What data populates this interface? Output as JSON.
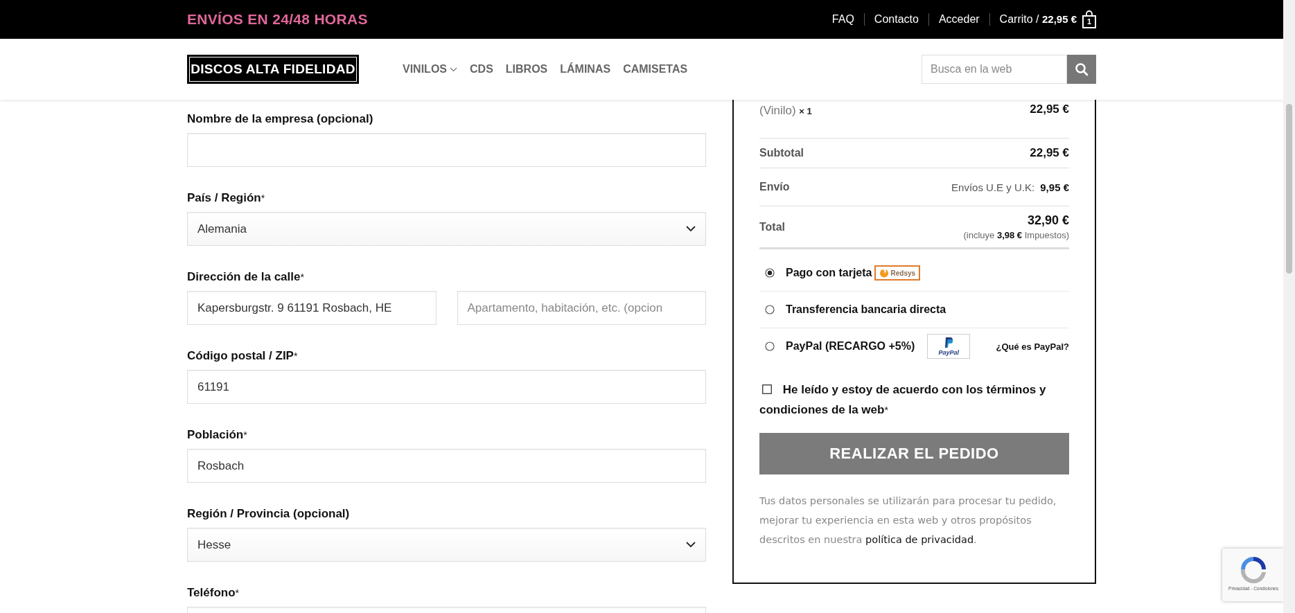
{
  "top_bar": {
    "promo": "ENVÍOS EN 24/48 HORAS",
    "links": [
      "FAQ",
      "Contacto",
      "Acceder"
    ],
    "cart": {
      "label": "Carrito /",
      "total": "22,95 €",
      "count": "1"
    }
  },
  "header": {
    "logo": "DISCOS ALTA FIDELIDAD",
    "nav": [
      {
        "label": "VINILOS",
        "has_submenu": true
      },
      {
        "label": "CDS",
        "has_submenu": false
      },
      {
        "label": "LIBROS",
        "has_submenu": false
      },
      {
        "label": "LÁMINAS",
        "has_submenu": false
      },
      {
        "label": "CAMISETAS",
        "has_submenu": false
      }
    ],
    "search": {
      "placeholder": "Busca en la web"
    }
  },
  "billing_form": [
    {
      "columns": [
        {
          "label": "Nombre de la empresa (opcional)",
          "inputs": [
            {
              "kind": "text"
            }
          ]
        }
      ]
    },
    {
      "columns": [
        {
          "label": "País / Región",
          "required_mark": "*",
          "inputs": [
            {
              "kind": "select",
              "value": "Alemania"
            }
          ]
        }
      ]
    },
    {
      "columns": [
        {
          "label": "Dirección de la calle",
          "required_mark": "*",
          "inputs": [
            {
              "kind": "text",
              "value": "Kapersburgstr. 9 61191 Rosbach, HE"
            },
            {
              "kind": "text",
              "placeholder": "Apartamento, habitación, etc. (opcion"
            }
          ]
        }
      ]
    },
    {
      "columns": [
        {
          "label": "Código postal / ZIP",
          "required_mark": "*",
          "inputs": [
            {
              "kind": "text",
              "value": "61191"
            }
          ]
        }
      ]
    },
    {
      "columns": [
        {
          "label": "Población",
          "required_mark": "*",
          "inputs": [
            {
              "kind": "text",
              "value": "Rosbach"
            }
          ]
        }
      ]
    },
    {
      "columns": [
        {
          "label": "Región / Provincia (opcional)",
          "inputs": [
            {
              "kind": "select",
              "value": "Hesse"
            }
          ]
        }
      ]
    },
    {
      "columns": [
        {
          "label": "Teléfono",
          "required_mark": "*",
          "inputs": [
            {
              "kind": "text"
            }
          ]
        }
      ]
    }
  ],
  "order_summary": {
    "items": [
      {
        "variant": "(Vinilo)",
        "quantity": "× 1",
        "price": "22,95 €"
      }
    ],
    "subtotal": {
      "label": "Subtotal",
      "value": "22,95 €"
    },
    "shipping": {
      "label": "Envío",
      "method": "Envíos U.E y U.K:",
      "value": "9,95 €"
    },
    "total": {
      "label": "Total",
      "value": "32,90 €",
      "tax_note": "(incluye **3,98 €** Impuestos)"
    }
  },
  "payment_methods": [
    {
      "label": "Pago con tarjeta",
      "selected": true,
      "logo": {
        "kind": "redsys",
        "text": "Redsys"
      }
    },
    {
      "label": "Transferencia bancaria directa",
      "selected": false
    },
    {
      "label": "PayPal (RECARGO +5%)",
      "selected": false,
      "logo": {
        "kind": "paypal",
        "text": "PayPal"
      },
      "link": "¿Qué es PayPal?"
    }
  ],
  "terms": {
    "checked": false,
    "text": "He leído y estoy de acuerdo con los términos y condiciones de la web",
    "required_mark": "*"
  },
  "place_order_button": "REALIZAR EL PEDIDO",
  "privacy_note": {
    "text": "Tus datos personales se utilizarán para procesar tu pedido, mejorar tu experiencia en esta web y otros propósitos descritos en nuestra",
    "link": "política de privacidad",
    "end": "."
  },
  "recaptcha": {
    "links": "Privacidad - Condiciones"
  }
}
